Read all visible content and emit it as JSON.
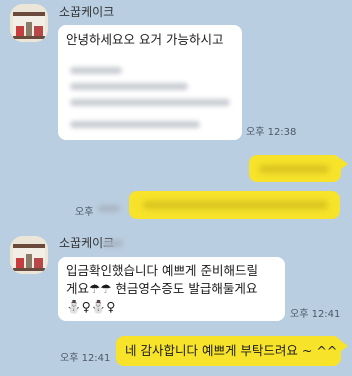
{
  "colors": {
    "background": "#b9cee0",
    "incoming_bubble": "#ffffff",
    "outgoing_bubble": "#f6e32a"
  },
  "messages": [
    {
      "sender": "소꿉케이크",
      "direction": "incoming",
      "text": "안녕하세요오 요거 가능하시고",
      "time": "오후 12:38"
    },
    {
      "direction": "outgoing"
    },
    {
      "direction": "outgoing",
      "time": "오후"
    },
    {
      "sender": "소꿉케이크",
      "direction": "incoming",
      "lines": [
        "입금확인했습니다 예쁘게 준비해드릴",
        "게요☂☂ 현금영수증도 발급해둘게요",
        "⛄♀⛄♀"
      ],
      "time": "오후 12:41"
    },
    {
      "direction": "outgoing",
      "text": "네 감사합니다 예쁘게 부탁드려요 ~ ^^",
      "time": "오후 12:41"
    }
  ]
}
